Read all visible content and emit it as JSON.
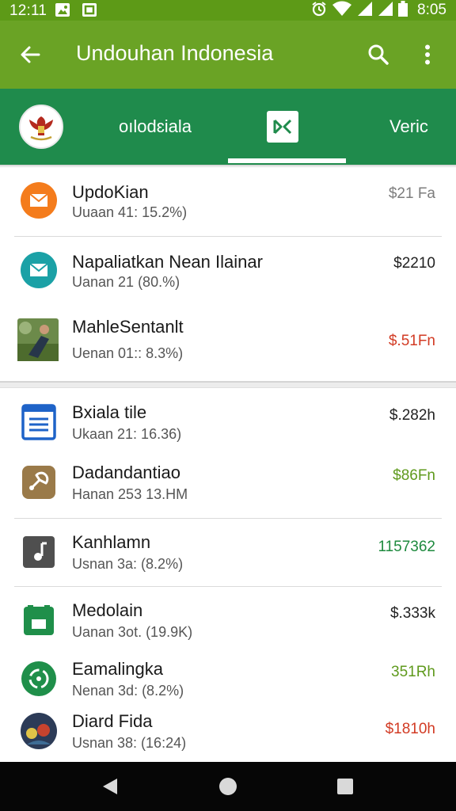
{
  "status_bar": {
    "time": "12:11",
    "right_time": "8:05",
    "icons": [
      "image-notification-icon",
      "app-notification-icon",
      "alarm-icon",
      "wifi-icon",
      "signal-icon",
      "signal-icon",
      "battery-icon"
    ]
  },
  "app_bar": {
    "title": "Undouhan Indonesia"
  },
  "tabs": [
    {
      "label": "oılodɛiala"
    },
    {
      "label": ""
    },
    {
      "label": "Veric"
    }
  ],
  "colors": {
    "status_bar": "#5d9a17",
    "app_bar": "#6aa325",
    "tab_bar": "#1f8b4c",
    "price_grey": "#7d7d7d",
    "price_black": "#222222",
    "price_red": "#d23b24",
    "price_green": "#5f9a1d",
    "price_dark_green": "#1e8a3e"
  },
  "list_1": [
    {
      "icon": "email-icon",
      "title": "UpdoKian",
      "subtitle": "Uuaan 41: 15.2%)",
      "price": "$21 Fa",
      "price_color": "#7d7d7d"
    },
    {
      "icon": "email-icon",
      "title": "Napaliatkan Nean Ilainar",
      "subtitle": "Uanan 21 (80.%)",
      "price": "$2210",
      "price_color": "#222222"
    },
    {
      "icon": "photo-thumbnail-icon",
      "title": "MahleSentanlt",
      "subtitle": "Uenan 01:: 8.3%)",
      "price": "$.51Fn",
      "price_color": "#d23b24"
    }
  ],
  "list_2": [
    {
      "icon": "document-icon",
      "title": "Bxiala tile",
      "subtitle": "Ukaan 21: 16.36)",
      "price": "$.282h",
      "price_color": "#222222"
    },
    {
      "icon": "share-app-icon",
      "title": "Dadandantiao",
      "subtitle": "Hanan 253 13.HM",
      "price": "$86Fn",
      "price_color": "#5f9a1d"
    },
    {
      "icon": "music-icon",
      "title": "Kanhlamn",
      "subtitle": "Usnan 3a: (8.2%)",
      "price": "1157362",
      "price_color": "#1e8a3e"
    },
    {
      "icon": "classroom-icon",
      "title": "Medolain",
      "subtitle": "Uanan 3ot. (19.9K)",
      "price": "$.333k",
      "price_color": "#222222"
    },
    {
      "icon": "sync-icon",
      "title": "Eamalingka",
      "subtitle": "Nenan 3d: (8.2%)",
      "price": "351Rh",
      "price_color": "#5f9a1d"
    },
    {
      "icon": "photo-avatar-icon",
      "title": "Diard Fida",
      "subtitle": "Usnan 38: (16:24)",
      "price": "$1810h",
      "price_color": "#d23b24"
    }
  ]
}
